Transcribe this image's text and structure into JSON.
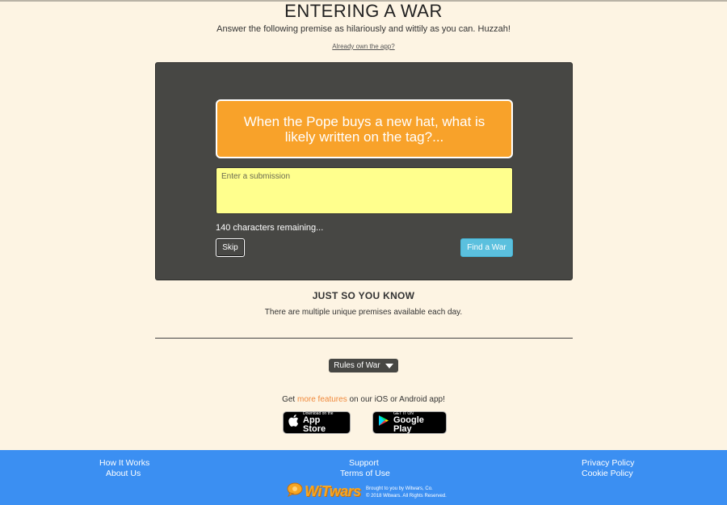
{
  "header": {
    "title": "ENTERING A WAR",
    "subtitle": "Answer the following premise as hilariously and wittily as you can. Huzzah!",
    "own_app_link": "Already own the app?"
  },
  "war": {
    "premise": "When the Pope buys a new hat, what is likely written on the tag?...",
    "submission_placeholder": "Enter a submission",
    "submission_value": "",
    "chars_remaining": "140 characters remaining...",
    "skip_label": "Skip",
    "find_label": "Find a War"
  },
  "info": {
    "heading": "JUST SO YOU KNOW",
    "text": "There are multiple unique premises available each day."
  },
  "rules": {
    "label": "Rules of War"
  },
  "promo": {
    "prefix": "Get ",
    "link": "more features",
    "suffix": " on our iOS or Android app!",
    "accent_color": "#f0883a",
    "app_store": {
      "small": "Download on the",
      "big": "App Store",
      "icon": "apple-icon"
    },
    "google_play": {
      "small": "GET IT ON",
      "big": "Google Play",
      "icon": "play-icon"
    }
  },
  "footer": {
    "how_it_works": "How It Works",
    "about_us": "About Us",
    "support": "Support",
    "terms": "Terms of Use",
    "privacy": "Privacy Policy",
    "cookie": "Cookie Policy",
    "logo_text": "WiTwars",
    "brought_by": "Brought to you by Witwars, Co.",
    "copyright": "© 2018 Witwars. All Rights Reserved.",
    "bg_color": "#3b8ff2"
  },
  "colors": {
    "page_bg": "#fdf4e3",
    "panel_bg": "#474744",
    "premise_bg": "#f8a22a",
    "submission_bg": "#ffff8d",
    "find_button": "#5bc0de"
  }
}
